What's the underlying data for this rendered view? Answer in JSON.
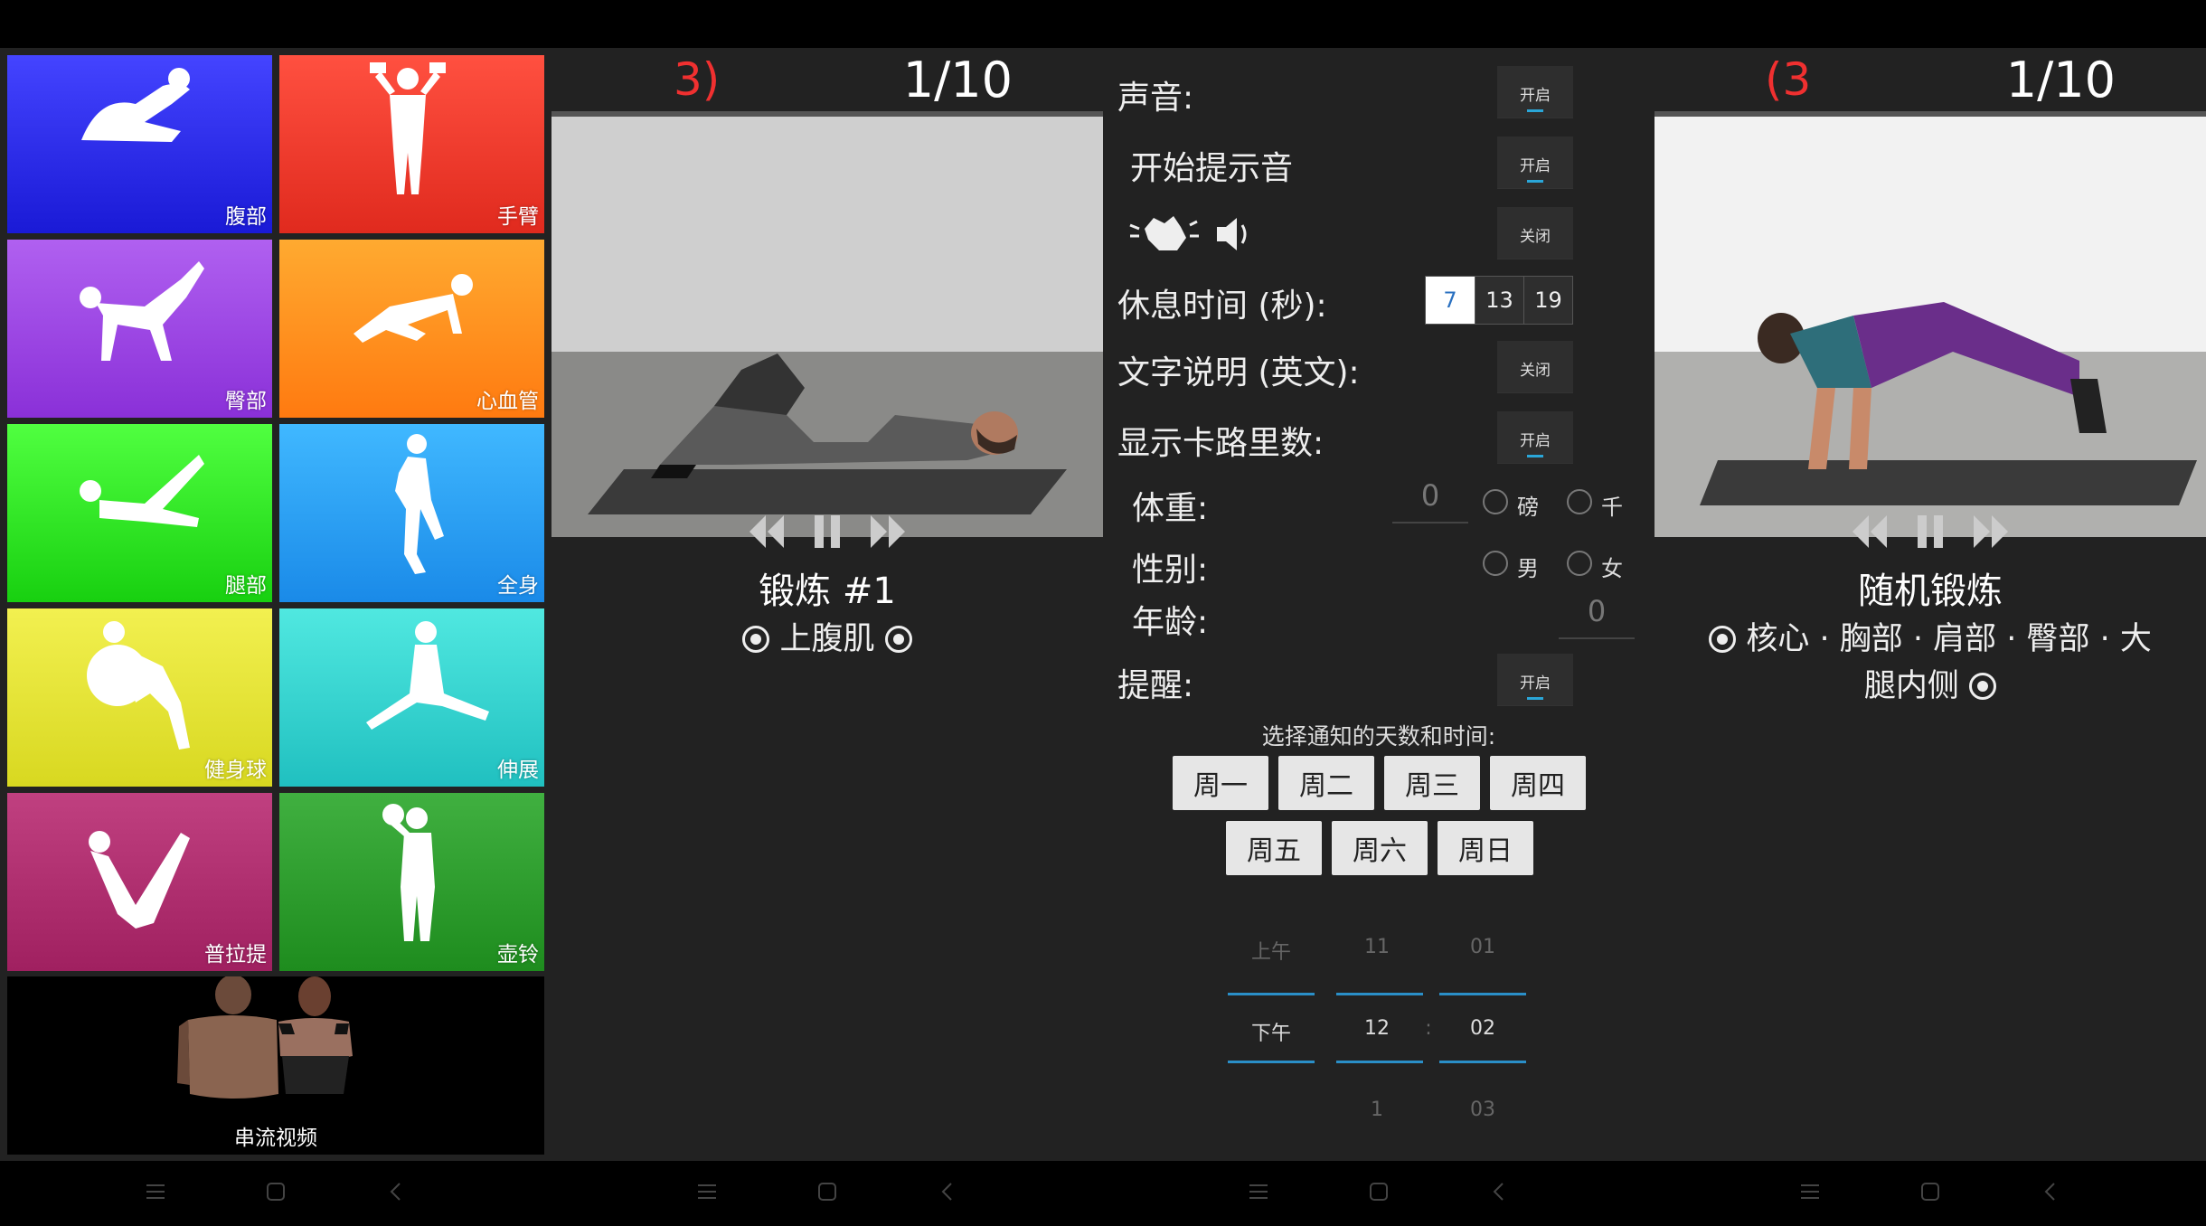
{
  "categories": [
    {
      "label": "腹部",
      "color_top": "#4444ff",
      "color_bottom": "#1a1ad6",
      "icon": "crunch-figure-icon"
    },
    {
      "label": "手臂",
      "color_top": "#ff5040",
      "color_bottom": "#e02a1e",
      "icon": "dumbbell-curl-figure-icon"
    },
    {
      "label": "臀部",
      "color_top": "#b060f0",
      "color_bottom": "#8a30d8",
      "icon": "donkey-kick-figure-icon"
    },
    {
      "label": "心血管",
      "color_top": "#ffaa30",
      "color_bottom": "#ff7a10",
      "icon": "mountain-climber-figure-icon"
    },
    {
      "label": "腿部",
      "color_top": "#50ff40",
      "color_bottom": "#18d010",
      "icon": "leg-raise-figure-icon"
    },
    {
      "label": "全身",
      "color_top": "#40b8ff",
      "color_bottom": "#1a8ae8",
      "icon": "running-figure-icon"
    },
    {
      "label": "健身球",
      "color_top": "#f2f050",
      "color_bottom": "#d8d820",
      "icon": "fitness-ball-figure-icon"
    },
    {
      "label": "伸展",
      "color_top": "#50e8e0",
      "color_bottom": "#20c0c0",
      "icon": "stretch-figure-icon"
    },
    {
      "label": "普拉提",
      "color_top": "#c04080",
      "color_bottom": "#a02060",
      "icon": "v-sit-figure-icon"
    },
    {
      "label": "壶铃",
      "color_top": "#40b040",
      "color_bottom": "#1e8c1e",
      "icon": "kettlebell-figure-icon"
    }
  ],
  "stream": {
    "label": "串流视频"
  },
  "player1": {
    "countdown": "3)",
    "progress": "1/10",
    "title": "锻炼 #1",
    "tags": "上腹肌"
  },
  "player2": {
    "countdown": "(3",
    "progress": "1/10",
    "title": "随机锻炼",
    "tags_line1": "核心 · 胸部 · 肩部 · 臀部 · 大",
    "tags_line2": "腿内侧"
  },
  "settings": {
    "sound_label": "声音:",
    "sound_state": "开启",
    "start_tone_label": "开始提示音",
    "start_tone_state": "开启",
    "clap_state": "关闭",
    "rest_label": "休息时间 (秒):",
    "rest_options": [
      "7",
      "13",
      "19"
    ],
    "text_label": "文字说明 (英文):",
    "text_state": "关闭",
    "calories_label": "显示卡路里数:",
    "calories_state": "开启",
    "weight_label": "体重:",
    "weight_value": "0",
    "unit_lb": "磅",
    "unit_kg": "千",
    "gender_label": "性别:",
    "male": "男",
    "female": "女",
    "age_label": "年龄:",
    "age_value": "0",
    "reminder_label": "提醒:",
    "reminder_state": "开启",
    "notify_text": "选择通知的天数和时间:",
    "days": [
      "周一",
      "周二",
      "周三",
      "周四",
      "周五",
      "周六",
      "周日"
    ],
    "picker": {
      "ampm": [
        "上午",
        "下午",
        ""
      ],
      "hour": [
        "11",
        "12",
        "1"
      ],
      "minute": [
        "01",
        "02",
        "03"
      ],
      "separator": ":"
    }
  }
}
